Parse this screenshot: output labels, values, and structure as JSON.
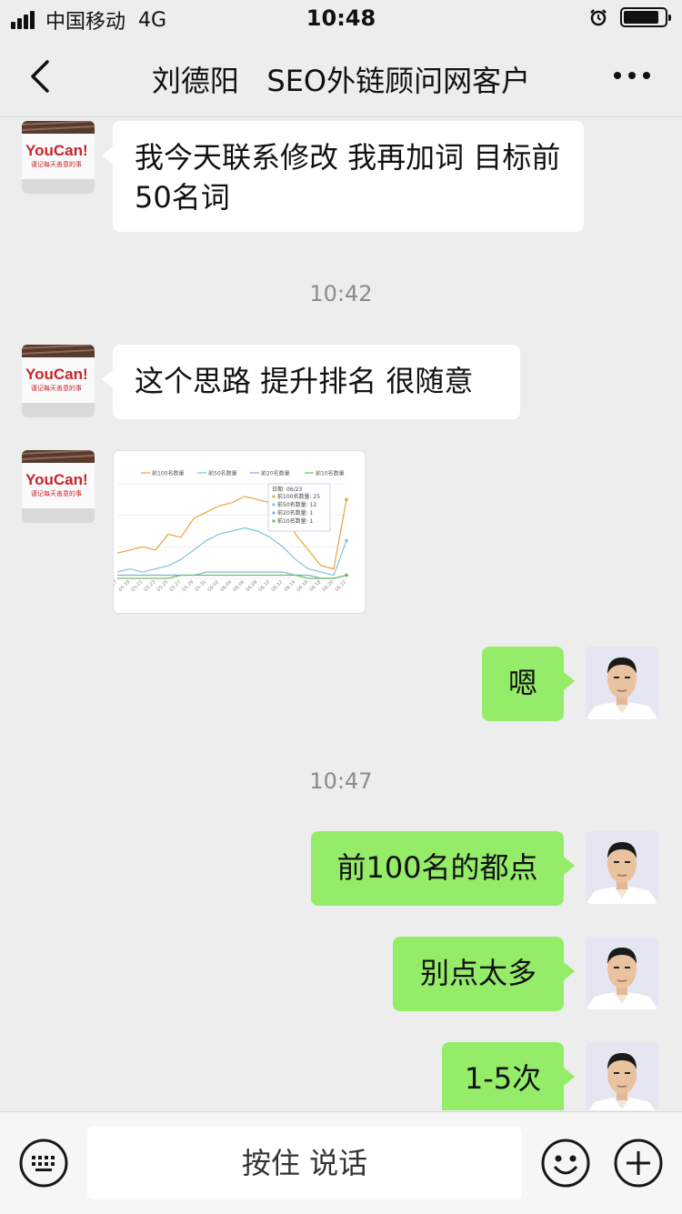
{
  "status_bar": {
    "carrier": "中国移动",
    "network": "4G",
    "time": "10:48"
  },
  "navbar": {
    "title": "刘德阳   SEO外链顾问网客户"
  },
  "messages": {
    "m1_text": "我今天联系修改 我再加词 目标前50名词",
    "ts1": "10:42",
    "m2_text": "这个思路 提升排名 很随意",
    "m4_text": "嗯",
    "ts2": "10:47",
    "m5_text": "前100名的都点",
    "m6_text": "别点太多",
    "m7_text": "1-5次"
  },
  "avatar": {
    "brand_text": "YouCan!",
    "brand_sub": "谨记每天善意的事"
  },
  "chart_data": {
    "type": "line",
    "legend": [
      "前100名数量",
      "前50名数量",
      "前20名数量",
      "前10名数量"
    ],
    "x": [
      "05:17",
      "05:19",
      "05:21",
      "05:23",
      "05:25",
      "05:27",
      "05:29",
      "05:31",
      "06:02",
      "06:04",
      "06:06",
      "06:08",
      "06:10",
      "06:12",
      "06:14",
      "06:16",
      "06:18",
      "06:20",
      "06:22"
    ],
    "series": [
      {
        "name": "前100名数量",
        "values": [
          8,
          9,
          10,
          9,
          14,
          13,
          19,
          21,
          23,
          24,
          26,
          25,
          24,
          22,
          14,
          9,
          4,
          3,
          25
        ]
      },
      {
        "name": "前50名数量",
        "values": [
          2,
          3,
          2,
          3,
          4,
          6,
          9,
          12,
          14,
          15,
          16,
          15,
          13,
          10,
          6,
          3,
          2,
          1,
          12
        ]
      },
      {
        "name": "前20名数量",
        "values": [
          1,
          1,
          1,
          1,
          1,
          1,
          1,
          2,
          2,
          2,
          2,
          2,
          2,
          2,
          1,
          1,
          0,
          0,
          1
        ]
      },
      {
        "name": "前10名数量",
        "values": [
          0,
          0,
          0,
          0,
          0,
          1,
          1,
          1,
          1,
          1,
          1,
          1,
          1,
          1,
          1,
          0,
          0,
          0,
          1
        ]
      }
    ],
    "tooltip": {
      "date": "日期: 06/23",
      "rows": [
        "前100名数量: 25",
        "前50名数量: 12",
        "前20名数量: 1",
        "前10名数量: 1"
      ]
    },
    "colors": [
      "#e9a33c",
      "#7cc6dc",
      "#8aa9d8",
      "#66c35a"
    ],
    "ylim": [
      0,
      30
    ]
  },
  "input_bar": {
    "voice_label": "按住 说话"
  },
  "colors": {
    "self_bubble": "#95ec69",
    "other_bubble": "#ffffff",
    "background": "#ededed"
  }
}
